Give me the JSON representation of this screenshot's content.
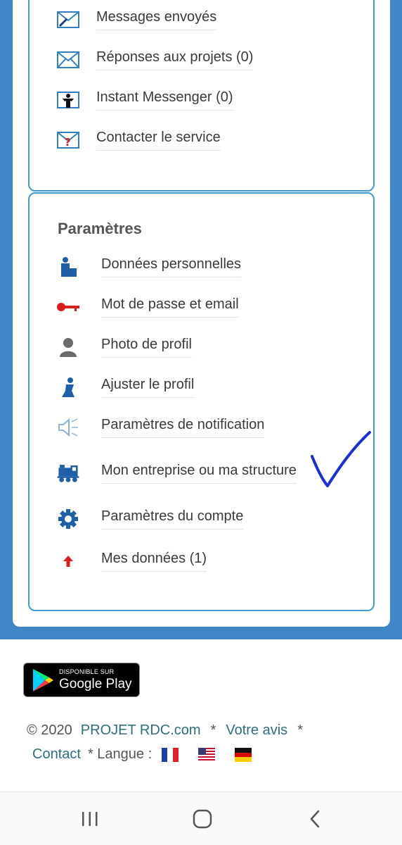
{
  "messages": {
    "items": [
      {
        "label": "Messages envoyés",
        "icon": "envelope-pen-icon"
      },
      {
        "label": "Réponses aux projets (0)",
        "icon": "envelope-icon"
      },
      {
        "label": "Instant Messenger (0)",
        "icon": "messenger-person-icon"
      },
      {
        "label": "Contacter le service",
        "icon": "contact-service-icon"
      }
    ]
  },
  "settings": {
    "title": "Paramètres",
    "items": [
      {
        "label": "Données personnelles",
        "icon": "person-data-icon"
      },
      {
        "label": "Mot de passe et email",
        "icon": "key-icon"
      },
      {
        "label": "Photo de profil",
        "icon": "person-silhouette-icon"
      },
      {
        "label": "Ajuster le profil",
        "icon": "profile-adjust-icon"
      },
      {
        "label": "Paramètres de notification",
        "icon": "speaker-icon"
      },
      {
        "label": "Mon entreprise ou ma structure",
        "icon": "train-icon"
      },
      {
        "label": "Paramètres du compte",
        "icon": "gear-icon"
      },
      {
        "label": "Mes données (1)",
        "icon": "red-arrow-up-icon"
      }
    ]
  },
  "google_play": {
    "small_text": "DISPONIBLE SUR",
    "big_text": "Google Play"
  },
  "footer": {
    "copyright": "© 2020",
    "site_link": "PROJET RDC.com",
    "sep1": "*",
    "feedback_link": "Votre avis",
    "sep2": "*",
    "contact_link": "Contact",
    "language_label": "* Langue :"
  },
  "colors": {
    "accent_blue": "#3f86c7",
    "box_border": "#3f9bd2",
    "link": "#2d6f7a",
    "checkmark": "#1a2fd6"
  }
}
